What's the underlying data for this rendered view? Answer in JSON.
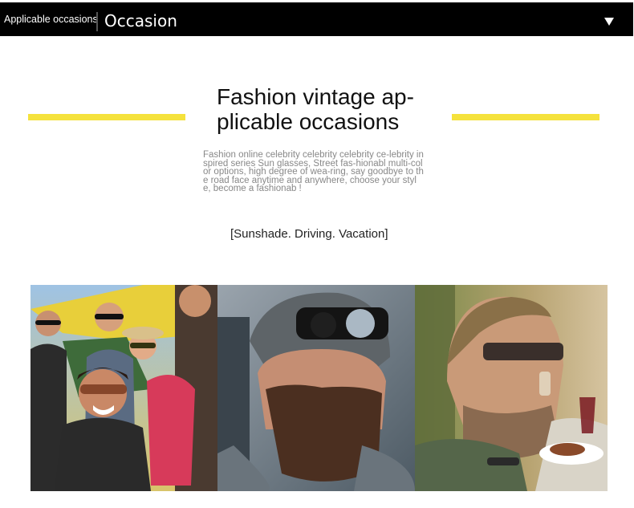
{
  "header": {
    "small_label": "Applicable occasions",
    "title": "Occasion"
  },
  "main": {
    "heading_line1": "Fashion vintage ap-",
    "heading_line2": "plicable occasions",
    "description": "Fashion online celebrity celebrity celebrity ce-lebrity inspired series Sun glasses, Street fas-hionabl multi-color options, high degree of wea-ring, say goodbye to the road face anytime and anywhere, choose your style, become a fashionab !",
    "occasions": "[Sunshade. Driving. Vacation]"
  },
  "colors": {
    "accent_yellow": "#f5e23c",
    "header_bg": "#000000"
  },
  "icons": {
    "dropdown": "triangle-down-icon"
  }
}
